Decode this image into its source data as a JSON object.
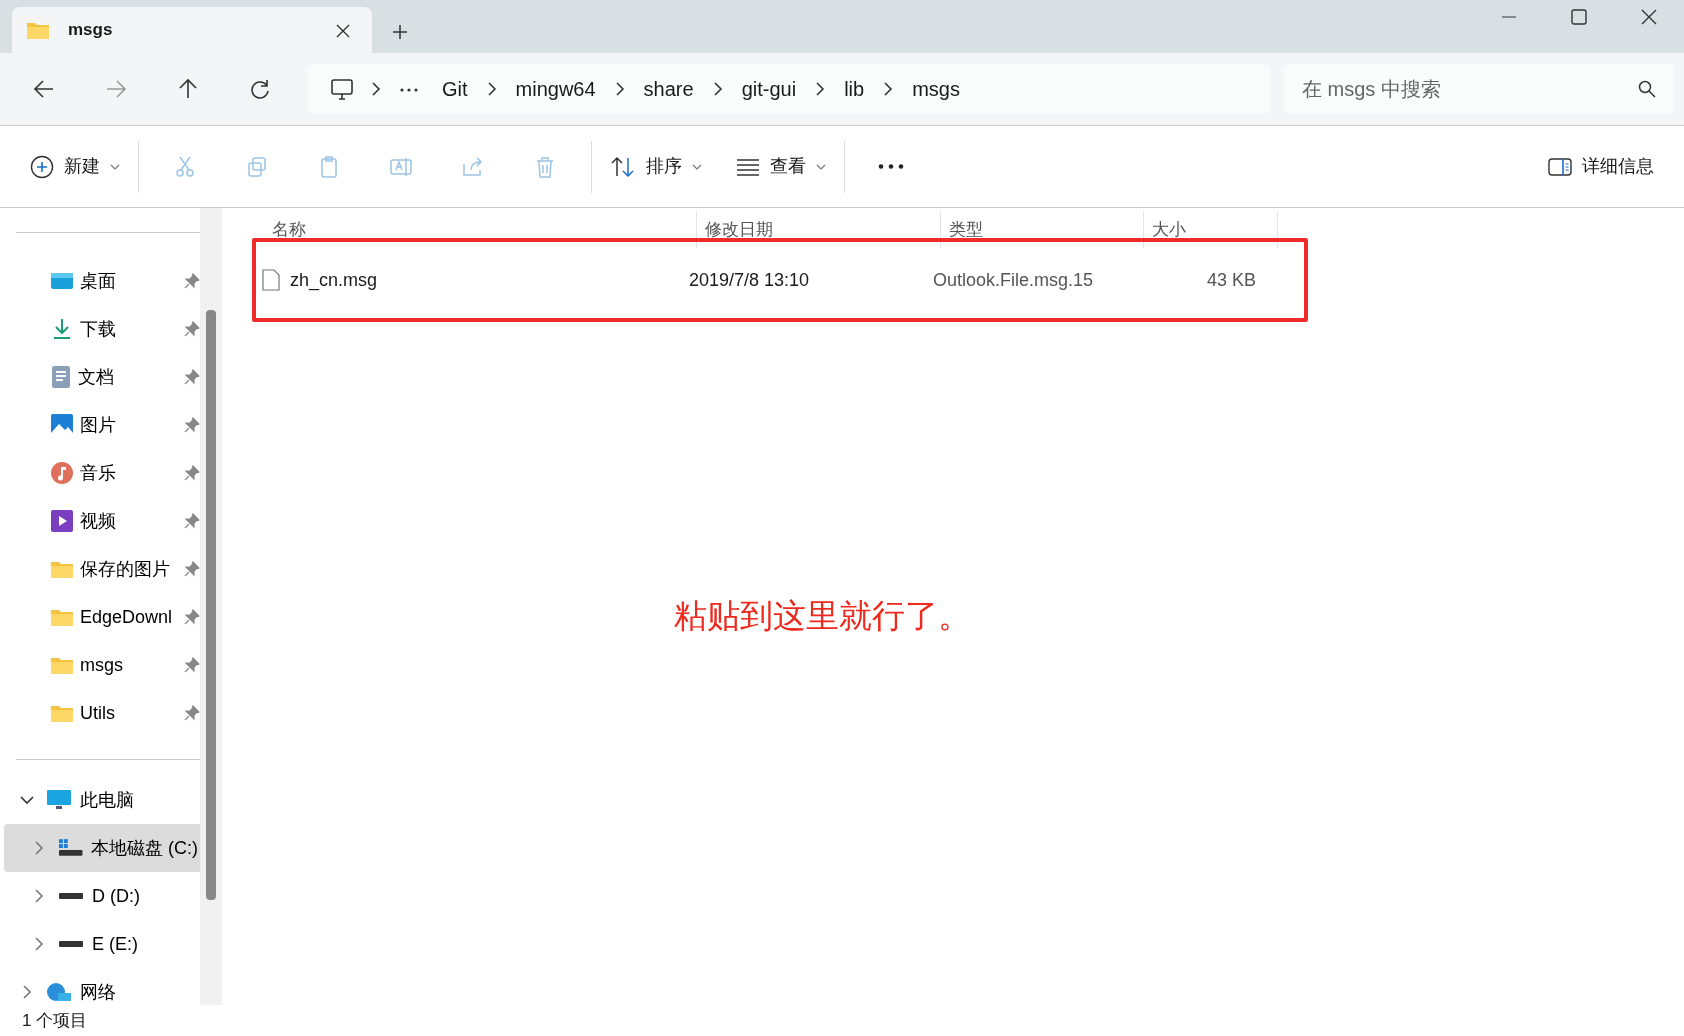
{
  "window": {
    "tab": {
      "title": "msgs"
    }
  },
  "nav": {
    "breadcrumb": [
      "Git",
      "mingw64",
      "share",
      "git-gui",
      "lib",
      "msgs"
    ],
    "search": {
      "placeholder": "在 msgs 中搜索"
    }
  },
  "toolbar": {
    "new": "新建",
    "sort": "排序",
    "view": "查看",
    "details": "详细信息"
  },
  "sidebar": {
    "quick_access": [
      {
        "label": "桌面",
        "kind": "desktop"
      },
      {
        "label": "下载",
        "kind": "download"
      },
      {
        "label": "文档",
        "kind": "document"
      },
      {
        "label": "图片",
        "kind": "pictures"
      },
      {
        "label": "音乐",
        "kind": "music"
      },
      {
        "label": "视频",
        "kind": "video"
      },
      {
        "label": "保存的图片",
        "kind": "folder"
      },
      {
        "label": "EdgeDownl",
        "kind": "folder"
      },
      {
        "label": "msgs",
        "kind": "folder"
      },
      {
        "label": "Utils",
        "kind": "folder"
      }
    ],
    "tree": [
      {
        "label": "此电脑",
        "kind": "pc",
        "expanded": true,
        "selected": false,
        "children": [
          {
            "label": "本地磁盘 (C:)",
            "kind": "windrive",
            "expanded": false,
            "selected": true
          },
          {
            "label": "D (D:)",
            "kind": "drive",
            "expanded": false,
            "selected": false
          },
          {
            "label": "E (E:)",
            "kind": "drive",
            "expanded": false,
            "selected": false
          }
        ]
      },
      {
        "label": "网络",
        "kind": "network",
        "expanded": false,
        "selected": false
      }
    ]
  },
  "table": {
    "columns": [
      "名称",
      "修改日期",
      "类型",
      "大小"
    ],
    "rows": [
      {
        "name": "zh_cn.msg",
        "modified": "2019/7/8 13:10",
        "type": "Outlook.File.msg.15",
        "size": "43 KB"
      }
    ]
  },
  "annotation": {
    "text": "粘贴到这里就行了。"
  },
  "status_bar": {
    "count": "1 个项目"
  }
}
